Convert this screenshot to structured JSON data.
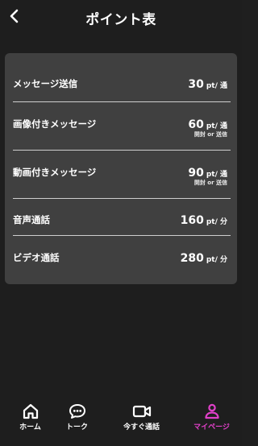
{
  "header": {
    "title": "ポイント表"
  },
  "points": [
    {
      "label": "メッセージ送信",
      "value": "30",
      "unit": "pt/ 通",
      "note": ""
    },
    {
      "label": "画像付きメッセージ",
      "value": "60",
      "unit": "pt/ 通",
      "note": "開封 or 送信"
    },
    {
      "label": "動画付きメッセージ",
      "value": "90",
      "unit": "pt/ 通",
      "note": "開封 or 送信"
    },
    {
      "label": "音声通話",
      "value": "160",
      "unit": "pt/ 分",
      "note": ""
    },
    {
      "label": "ビデオ通話",
      "value": "280",
      "unit": "pt/ 分",
      "note": ""
    }
  ],
  "tabbar": {
    "tabs": [
      {
        "label": "ホーム",
        "icon": "home-icon",
        "active": false
      },
      {
        "label": "トーク",
        "icon": "chat-icon",
        "active": false
      },
      {
        "label": "今すぐ通話",
        "icon": "video-camera-icon",
        "active": false
      },
      {
        "label": "マイページ",
        "icon": "person-icon",
        "active": true
      }
    ]
  },
  "colors": {
    "background": "#1e1e1e",
    "card": "#404040",
    "accent": "#e040c8"
  }
}
